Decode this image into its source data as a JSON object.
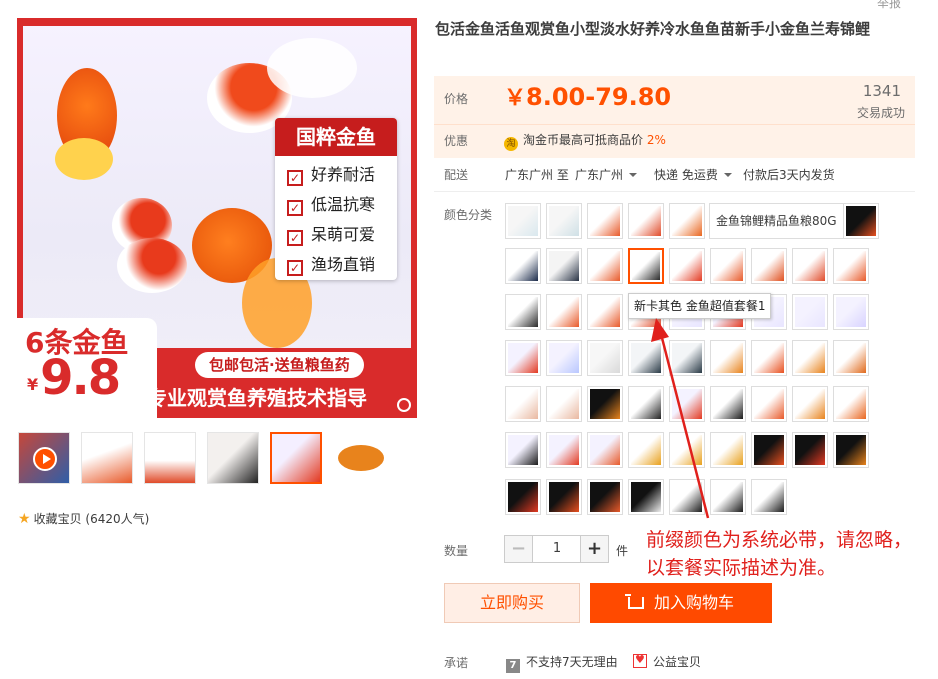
{
  "top_link": "举报",
  "gallery": {
    "badge_title": "国粹金鱼",
    "badge_items": [
      "好养耐活",
      "低温抗寒",
      "呆萌可爱",
      "渔场直销"
    ],
    "promo_count": "6条金鱼",
    "promo_yen": "¥",
    "promo_price": "9.8",
    "promo_pill": "包邮包活·送鱼粮鱼药",
    "promo_guide": "专业观赏鱼养殖技术指导",
    "thumbnails": [
      {
        "name": "video-thumb",
        "colors": [
          "#c6473a",
          "#2f5ea8"
        ]
      },
      {
        "name": "thumb-2",
        "colors": [
          "#ffffff",
          "#e85a2a"
        ]
      },
      {
        "name": "thumb-3",
        "colors": [
          "#ffffff",
          "#e04b2a"
        ]
      },
      {
        "name": "thumb-4",
        "colors": [
          "#f3f0ee",
          "#222222"
        ]
      },
      {
        "name": "thumb-5",
        "colors": [
          "#f4efff",
          "#e33a22"
        ]
      },
      {
        "name": "thumb-6",
        "colors": [
          "#ffffff",
          "#e8831c"
        ]
      }
    ]
  },
  "favorite": {
    "label": "收藏宝贝",
    "count": "(6420人气)"
  },
  "product": {
    "title": "包活金鱼活鱼观赏鱼小型淡水好养冷水鱼鱼苗新手小金鱼兰寿锦鲤"
  },
  "price": {
    "label": "价格",
    "value": "8.00-79.80",
    "yen": "￥",
    "sales_count": "1341",
    "sales_label": "交易成功"
  },
  "promo": {
    "label": "优惠",
    "icon": "淘",
    "text": "淘金币最高可抵商品价",
    "pct": "2%"
  },
  "shipping": {
    "label": "配送",
    "from": "广东广州 至",
    "to": "广东广州",
    "method": "快递 免运费",
    "dispatch": "付款后3天内发货"
  },
  "sku": {
    "label": "颜色分类",
    "text_option": "金鱼锦鲤精品鱼粮80G",
    "tooltip": "新卡其色 金鱼超值套餐1",
    "accent": "#ff5000"
  },
  "quantity": {
    "label": "数量",
    "minus": "−",
    "plus": "+",
    "value": "1",
    "unit": "件"
  },
  "buttons": {
    "buy_now": "立即购买",
    "add_to_cart": "加入购物车"
  },
  "promise": {
    "label": "承诺",
    "item1_icon": "7",
    "item1": "不支持7天无理由",
    "item2": "公益宝贝"
  },
  "annotation": {
    "text": "前缀颜色为系统必带，请忽略，以套餐实际描述为准。",
    "color": "#e0201c"
  }
}
